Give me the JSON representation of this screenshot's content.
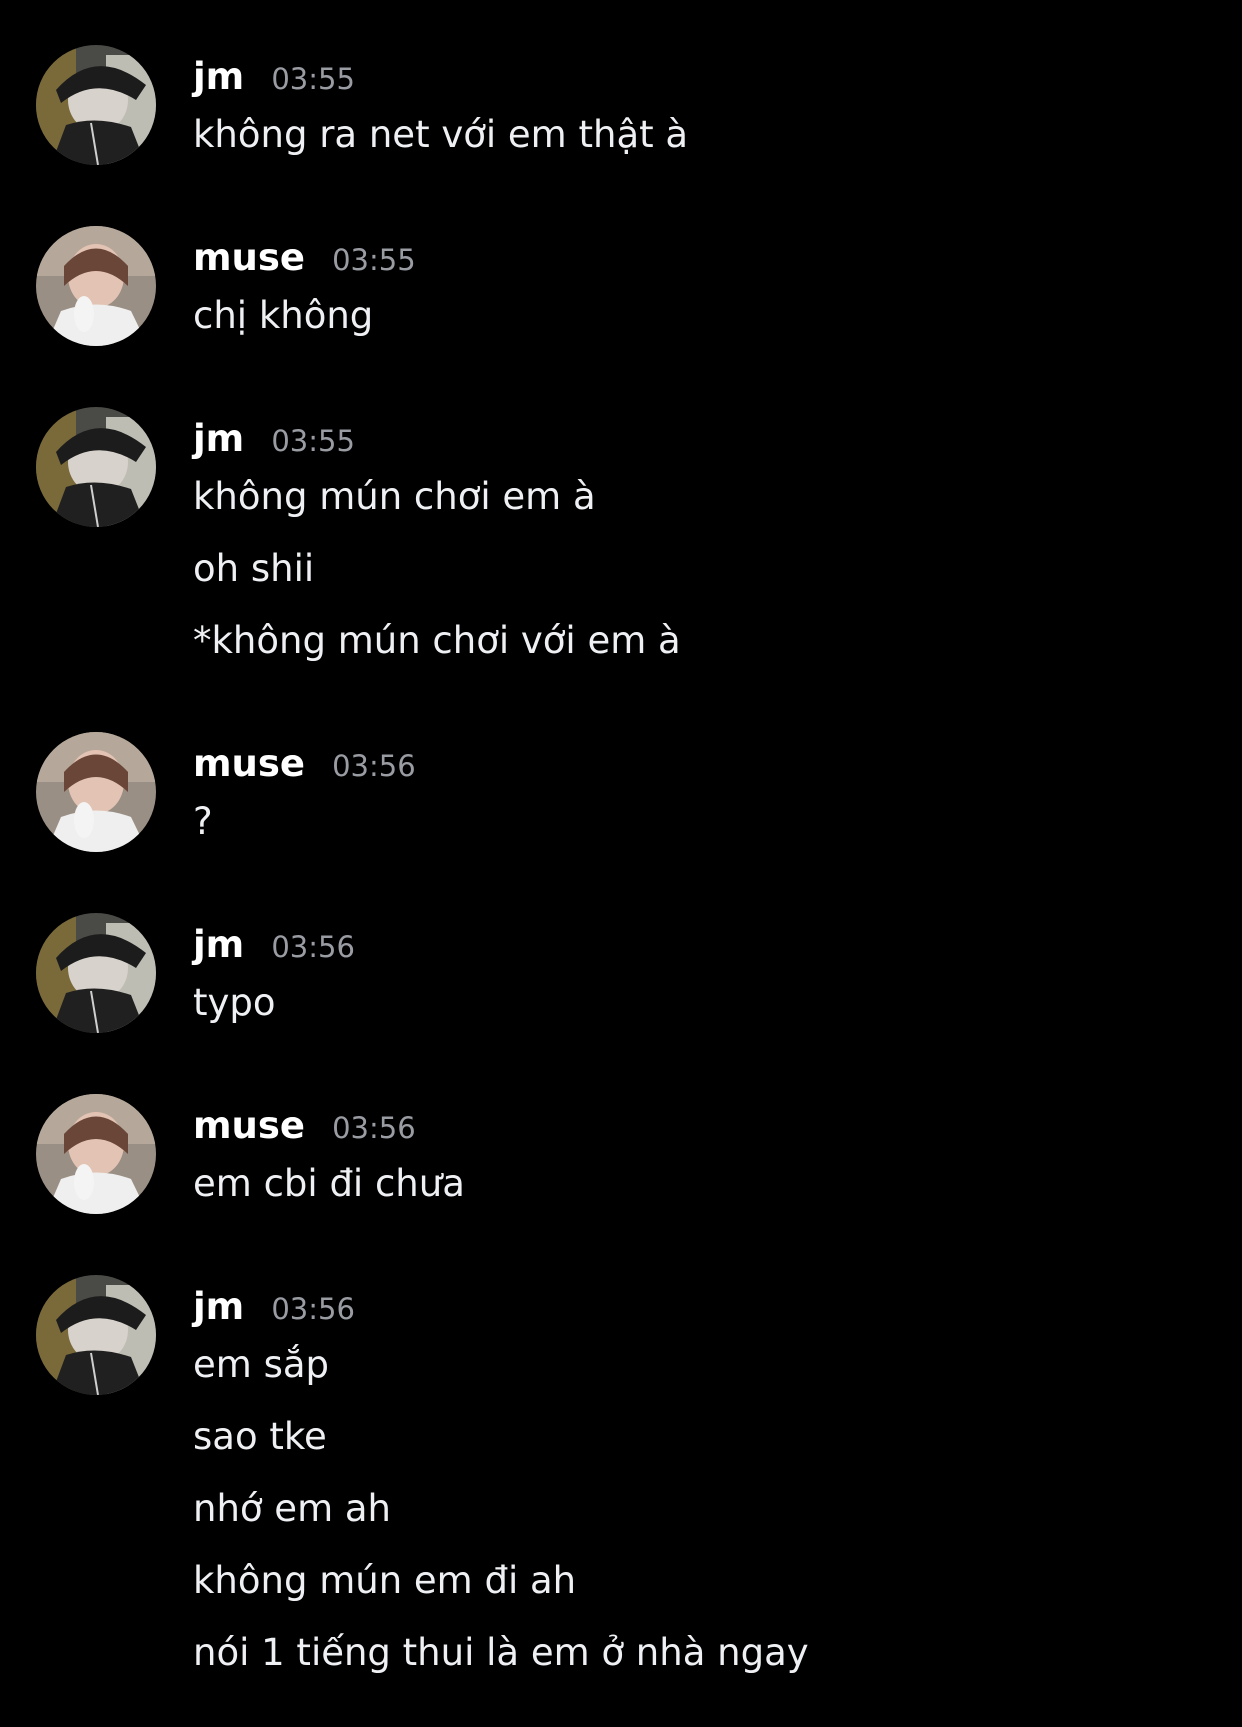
{
  "colors": {
    "background": "#000000",
    "username": "#ffffff",
    "timestamp": "#9a9ca3",
    "message_text": "#eef0f3"
  },
  "messages": [
    {
      "author": "jm",
      "avatar": "jm-avatar",
      "time": "03:55",
      "lines": [
        "không ra net với em thật à"
      ]
    },
    {
      "author": "muse",
      "avatar": "muse-avatar",
      "time": "03:55",
      "lines": [
        "chị không"
      ]
    },
    {
      "author": "jm",
      "avatar": "jm-avatar",
      "time": "03:55",
      "lines": [
        "không mún chơi em à",
        "oh shii",
        "*không mún chơi với em à"
      ]
    },
    {
      "author": "muse",
      "avatar": "muse-avatar",
      "time": "03:56",
      "lines": [
        "?"
      ]
    },
    {
      "author": "jm",
      "avatar": "jm-avatar",
      "time": "03:56",
      "lines": [
        "typo"
      ]
    },
    {
      "author": "muse",
      "avatar": "muse-avatar",
      "time": "03:56",
      "lines": [
        "em cbi đi chưa"
      ]
    },
    {
      "author": "jm",
      "avatar": "jm-avatar",
      "time": "03:56",
      "lines": [
        "em sắp",
        "sao tke",
        "nhớ em ah",
        "không mún em đi ah",
        "nói 1 tiếng thui là em ở nhà ngay"
      ]
    }
  ]
}
